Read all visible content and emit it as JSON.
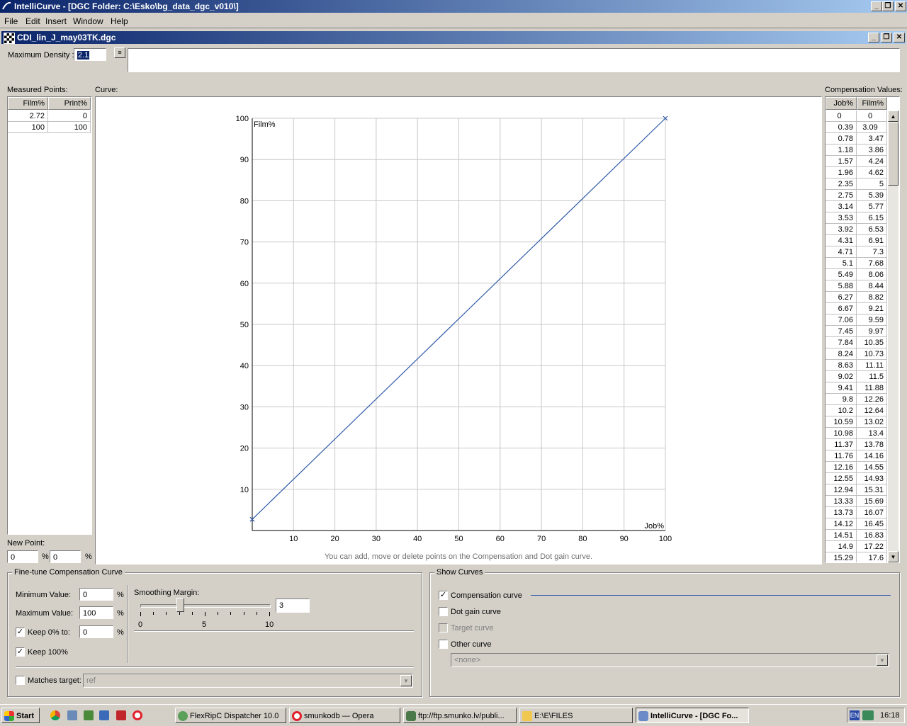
{
  "app": {
    "title": "IntelliCurve - [DGC Folder: C:\\Esko\\bg_data_dgc_v010\\]",
    "menu": [
      "File",
      "Edit",
      "Insert",
      "Window",
      "Help"
    ]
  },
  "doc": {
    "title": "CDI_lin_J_may03TK.dgc"
  },
  "density": {
    "label": "Maximum Density :",
    "value": "2.1",
    "note": ""
  },
  "measured": {
    "label": "Measured Points:",
    "headers": [
      "Film%",
      "Print%"
    ],
    "rows": [
      [
        "2.72",
        "0"
      ],
      [
        "100",
        "100"
      ]
    ]
  },
  "new_point": {
    "label": "New Point:",
    "x": "0",
    "y": "0",
    "unit": "%"
  },
  "curve": {
    "label": "Curve:",
    "hint": "You can add, move or delete points on the Compensation and Dot gain curve."
  },
  "chart_data": {
    "type": "line",
    "xlabel": "Job%",
    "ylabel": "Film%",
    "xlim": [
      0,
      100
    ],
    "ylim": [
      0,
      100
    ],
    "xticks": [
      10,
      20,
      30,
      40,
      50,
      60,
      70,
      80,
      90,
      100
    ],
    "yticks": [
      10,
      20,
      30,
      40,
      50,
      60,
      70,
      80,
      90,
      100
    ],
    "grid": true,
    "series": [
      {
        "color": "#2e5aa8",
        "x": [
          0,
          100
        ],
        "y": [
          2.72,
          100
        ],
        "markers": "x-at-ends"
      }
    ]
  },
  "comp": {
    "label": "Compensation Values:",
    "headers": [
      "Job%",
      "Film%"
    ],
    "rows": [
      [
        "0",
        "0"
      ],
      [
        "0.39",
        "3.09"
      ],
      [
        "0.78",
        "3.47"
      ],
      [
        "1.18",
        "3.86"
      ],
      [
        "1.57",
        "4.24"
      ],
      [
        "1.96",
        "4.62"
      ],
      [
        "2.35",
        "5"
      ],
      [
        "2.75",
        "5.39"
      ],
      [
        "3.14",
        "5.77"
      ],
      [
        "3.53",
        "6.15"
      ],
      [
        "3.92",
        "6.53"
      ],
      [
        "4.31",
        "6.91"
      ],
      [
        "4.71",
        "7.3"
      ],
      [
        "5.1",
        "7.68"
      ],
      [
        "5.49",
        "8.06"
      ],
      [
        "5.88",
        "8.44"
      ],
      [
        "6.27",
        "8.82"
      ],
      [
        "6.67",
        "9.21"
      ],
      [
        "7.06",
        "9.59"
      ],
      [
        "7.45",
        "9.97"
      ],
      [
        "7.84",
        "10.35"
      ],
      [
        "8.24",
        "10.73"
      ],
      [
        "8.63",
        "11.11"
      ],
      [
        "9.02",
        "11.5"
      ],
      [
        "9.41",
        "11.88"
      ],
      [
        "9.8",
        "12.26"
      ],
      [
        "10.2",
        "12.64"
      ],
      [
        "10.59",
        "13.02"
      ],
      [
        "10.98",
        "13.4"
      ],
      [
        "11.37",
        "13.78"
      ],
      [
        "11.76",
        "14.16"
      ],
      [
        "12.16",
        "14.55"
      ],
      [
        "12.55",
        "14.93"
      ],
      [
        "12.94",
        "15.31"
      ],
      [
        "13.33",
        "15.69"
      ],
      [
        "13.73",
        "16.07"
      ],
      [
        "14.12",
        "16.45"
      ],
      [
        "14.51",
        "16.83"
      ],
      [
        "14.9",
        "17.22"
      ],
      [
        "15.29",
        "17.6"
      ]
    ]
  },
  "finetune": {
    "title": "Fine-tune Compensation Curve",
    "min_label": "Minimum Value:",
    "min_value": "0",
    "max_label": "Maximum Value:",
    "max_value": "100",
    "keep0_label": "Keep 0% to:",
    "keep0_value": "0",
    "keep0_checked": true,
    "keep100_label": "Keep 100%",
    "keep100_checked": true,
    "unit": "%",
    "smoothing_label": "Smoothing Margin:",
    "smoothing_value": "3",
    "slider_min": "0",
    "slider_mid": "5",
    "slider_max": "10",
    "slider_level": 3,
    "matches_label": "Matches target:",
    "matches_checked": false,
    "matches_value": "ref"
  },
  "show": {
    "title": "Show Curves",
    "compensation": "Compensation curve",
    "compensation_checked": true,
    "compensation_color": "#2e5aa8",
    "dotgain": "Dot gain curve",
    "target": "Target curve",
    "other": "Other curve",
    "other_value": "<none>"
  },
  "taskbar": {
    "start": "Start",
    "tasks": [
      "FlexRipC Dispatcher 10.0",
      "smunkodb — Opera",
      "ftp://ftp.smunko.lv/publi...",
      "E:\\E\\FILES",
      "IntelliCurve - [DGC Fo..."
    ],
    "lang": "EN",
    "clock": "16:18"
  }
}
